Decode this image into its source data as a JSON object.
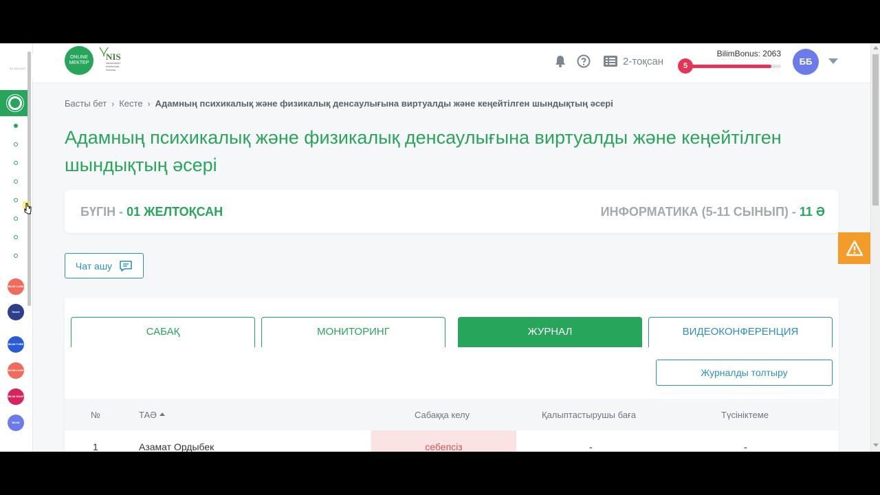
{
  "header": {
    "logo_online": "ONLINE MEKTEP",
    "logo_nis": "NIS",
    "logo_nis_sub": "Nazarbayev Intellectual Schools",
    "quarter": "2-тоқсан",
    "bonus_label": "BilimBonus: 2063",
    "bonus_level": "5",
    "bonus_progress": 0.9,
    "avatar_initials": "ББ"
  },
  "rail": {
    "brand": "BILIMLAND",
    "apps": [
      {
        "name": "bilimland",
        "color": "#f06b5c",
        "label": "BILIM LAND"
      },
      {
        "name": "smartnation",
        "color": "#2c3e8c",
        "label": "Smart Nation"
      },
      {
        "name": "bilimtube",
        "color": "#2a5bd7",
        "label": "BILIM TUBE"
      },
      {
        "name": "bilimland2",
        "color": "#f06b5c",
        "label": "BILIM LAND"
      },
      {
        "name": "bilimshop",
        "color": "#d6245c",
        "label": "BILIM SHOP"
      },
      {
        "name": "bilimmedia",
        "color": "#6c7bea",
        "label": "BILIM MEDIA"
      }
    ]
  },
  "breadcrumb": {
    "home": "Басты бет",
    "schedule": "Кесте",
    "current": "Адамның психикалық және физикалық денсаулығына виртуалды және кеңейтілген шындықтың әсері"
  },
  "page": {
    "title": "Адамның психикалық және физикалық денсаулығына виртуалды және кеңейтілген шындықтың әсері"
  },
  "day": {
    "today_label": "БҮГІН - ",
    "today_date": "01 ЖЕЛТОҚСАН",
    "subject": "ИНФОРМАТИКА (5-11 СЫНЫП) - ",
    "class": "11 Ә"
  },
  "chat": {
    "label": "Чат ашу"
  },
  "tabs": [
    {
      "label": "САБАҚ"
    },
    {
      "label": "МОНИТОРИНГ"
    },
    {
      "label": "ЖУРНАЛ"
    },
    {
      "label": "ВИДЕОКОНФЕРЕНЦИЯ"
    }
  ],
  "journal": {
    "fill_button": "Журналды толтыру",
    "columns": {
      "number": "№",
      "name": "ТАӘ",
      "attendance": "Сабаққа келу",
      "grade": "Қалыптастырушы баға",
      "comment": "Түсініктеме"
    },
    "rows": [
      {
        "number": "1",
        "name": "Азамат Ордыбек",
        "attendance": "себепсіз",
        "grade": "-",
        "comment": "-"
      }
    ]
  },
  "colors": {
    "green": "#27a65b",
    "blue": "#2b8fbf",
    "bonus": "#e5335a",
    "alert": "#f39c29",
    "avatar": "#6c7bea"
  }
}
